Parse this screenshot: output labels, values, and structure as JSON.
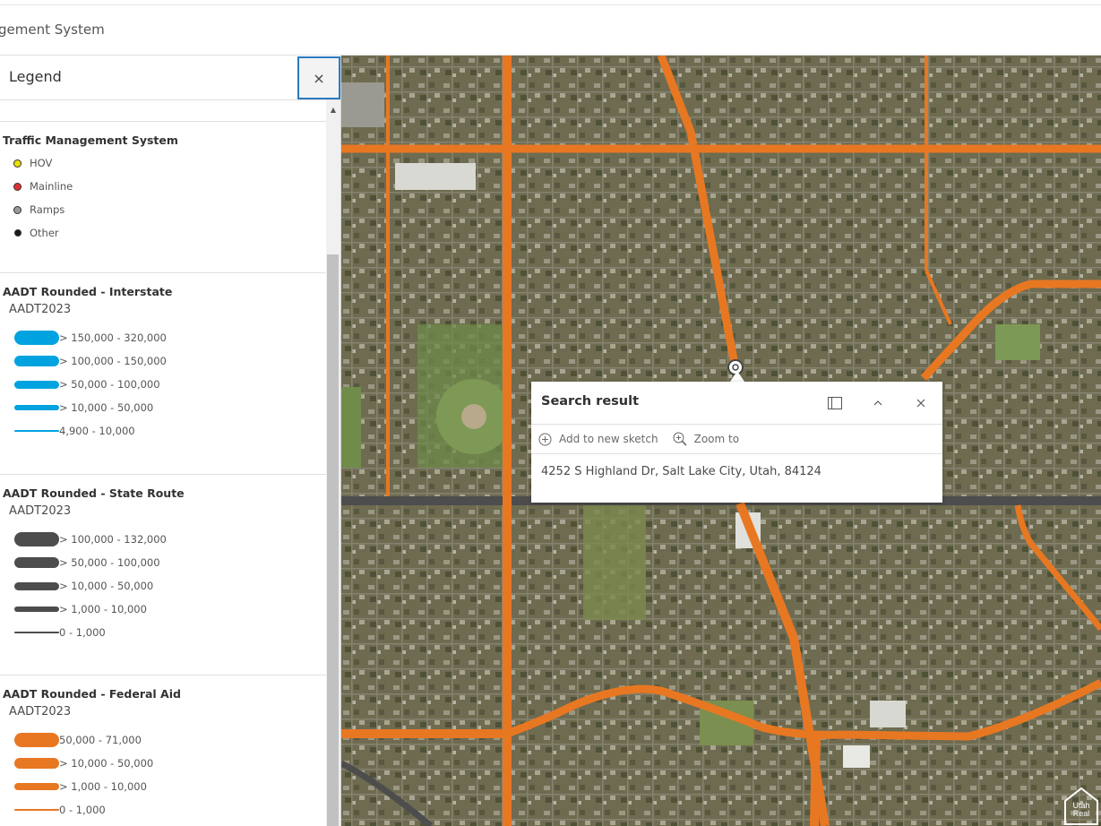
{
  "app": {
    "title": "gement System"
  },
  "legend_panel": {
    "title": "Legend",
    "close_label": "×",
    "layers": [
      {
        "title": "Traffic Management System",
        "type": "points",
        "items": [
          {
            "label": "HOV",
            "color": "#e8e000"
          },
          {
            "label": "Mainline",
            "color": "#e23030"
          },
          {
            "label": "Ramps",
            "color": "#9a9a9a"
          },
          {
            "label": "Other",
            "color": "#1a1a1a"
          }
        ]
      },
      {
        "title": "AADT Rounded - Interstate",
        "field": "AADT2023",
        "color": "#00a3e0",
        "items": [
          {
            "label": "> 150,000 - 320,000"
          },
          {
            "label": "> 100,000 - 150,000"
          },
          {
            "label": "> 50,000 - 100,000"
          },
          {
            "label": "> 10,000 - 50,000"
          },
          {
            "label": "4,900 - 10,000"
          }
        ]
      },
      {
        "title": "AADT Rounded - State Route",
        "field": "AADT2023",
        "color": "#4d4d4d",
        "items": [
          {
            "label": "> 100,000 - 132,000"
          },
          {
            "label": "> 50,000 - 100,000"
          },
          {
            "label": "> 10,000 - 50,000"
          },
          {
            "label": "> 1,000 - 10,000"
          },
          {
            "label": "0 - 1,000"
          }
        ]
      },
      {
        "title": "AADT Rounded - Federal Aid",
        "field": "AADT2023",
        "color": "#e87722",
        "items": [
          {
            "label": "50,000 - 71,000"
          },
          {
            "label": "> 10,000 - 50,000"
          },
          {
            "label": "> 1,000 - 10,000"
          },
          {
            "label": "0 - 1,000"
          }
        ]
      }
    ]
  },
  "popup": {
    "title": "Search result",
    "dock_icon": "dock-icon",
    "collapse_icon": "chevron-up-icon",
    "close_icon": "close-icon",
    "actions": [
      {
        "label": "Add to new sketch",
        "icon": "plus-circle-icon"
      },
      {
        "label": "Zoom to",
        "icon": "zoom-in-icon"
      }
    ],
    "address": "4252 S Highland Dr, Salt Lake City, Utah, 84124"
  },
  "map": {
    "road_color_federal": "#e87722",
    "road_color_state": "#4d4d4d",
    "watermark": "Utah Real Estate .com"
  }
}
